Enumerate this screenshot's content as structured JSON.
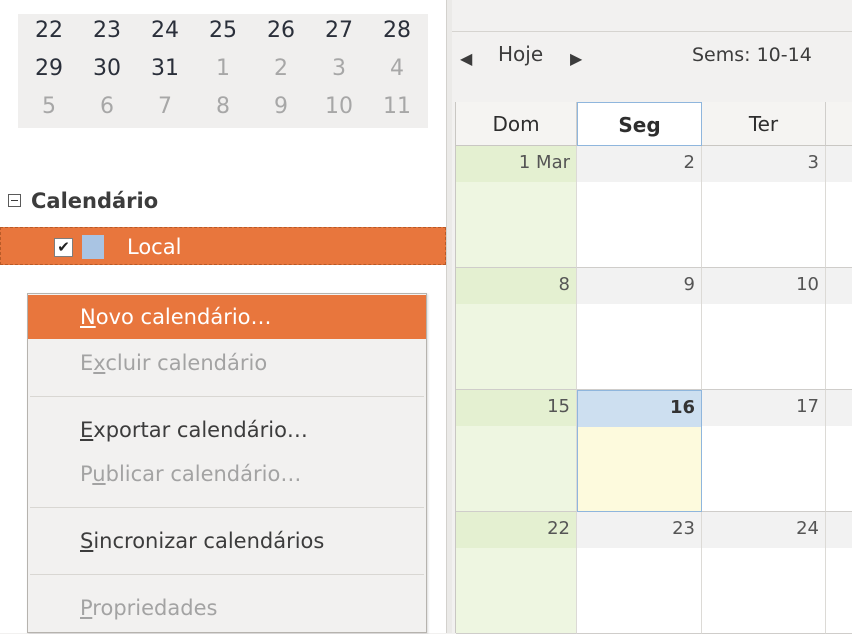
{
  "mini_calendar": {
    "rows": [
      [
        {
          "d": "22",
          "cur": true
        },
        {
          "d": "23",
          "cur": true
        },
        {
          "d": "24",
          "cur": true
        },
        {
          "d": "25",
          "cur": true
        },
        {
          "d": "26",
          "cur": true
        },
        {
          "d": "27",
          "cur": true
        },
        {
          "d": "28",
          "cur": true
        }
      ],
      [
        {
          "d": "29",
          "cur": true
        },
        {
          "d": "30",
          "cur": true
        },
        {
          "d": "31",
          "cur": true
        },
        {
          "d": "1",
          "cur": false
        },
        {
          "d": "2",
          "cur": false
        },
        {
          "d": "3",
          "cur": false
        },
        {
          "d": "4",
          "cur": false
        }
      ],
      [
        {
          "d": "5",
          "cur": false
        },
        {
          "d": "6",
          "cur": false
        },
        {
          "d": "7",
          "cur": false
        },
        {
          "d": "8",
          "cur": false
        },
        {
          "d": "9",
          "cur": false
        },
        {
          "d": "10",
          "cur": false
        },
        {
          "d": "11",
          "cur": false
        }
      ]
    ]
  },
  "calendar_list": {
    "header": "Calendário",
    "items": [
      {
        "label": "Local",
        "checked": true,
        "checkmark": "✔",
        "color": "#a9c4e3"
      }
    ]
  },
  "context_menu": {
    "items": [
      {
        "label": "Novo calendário…",
        "enabled": true,
        "highlighted": true,
        "accesskey_index": 0
      },
      {
        "label": "Excluir calendário",
        "enabled": false,
        "highlighted": false,
        "accesskey_index": 1
      },
      {
        "separator": true
      },
      {
        "label": "Exportar calendário…",
        "enabled": true,
        "highlighted": false,
        "accesskey_index": 0
      },
      {
        "label": "Publicar calendário…",
        "enabled": false,
        "highlighted": false,
        "accesskey_index": 1
      },
      {
        "separator": true
      },
      {
        "label": "Sincronizar calendários",
        "enabled": true,
        "highlighted": false,
        "accesskey_index": 0
      },
      {
        "separator": true
      },
      {
        "label": "Propriedades",
        "enabled": false,
        "highlighted": false,
        "accesskey_index": 0
      }
    ]
  },
  "toolbar": {
    "prev_icon": "◀",
    "today_label": "Hoje",
    "next_icon": "▶",
    "week_label": "Sems: 10-14"
  },
  "multiweek": {
    "column_headers": [
      "Dom",
      "Seg",
      "Ter"
    ],
    "today_column": 1,
    "weeks": [
      [
        "1 Mar",
        "2",
        "3"
      ],
      [
        "8",
        "9",
        "10"
      ],
      [
        "15",
        "16",
        "17"
      ],
      [
        "22",
        "23",
        "24"
      ]
    ],
    "today": {
      "week": 2,
      "day": 1
    }
  },
  "colors": {
    "accent": "#e8763d",
    "sunday": "#eef6e1",
    "today_header": "#cddff0",
    "today_body": "#fdfadd"
  }
}
